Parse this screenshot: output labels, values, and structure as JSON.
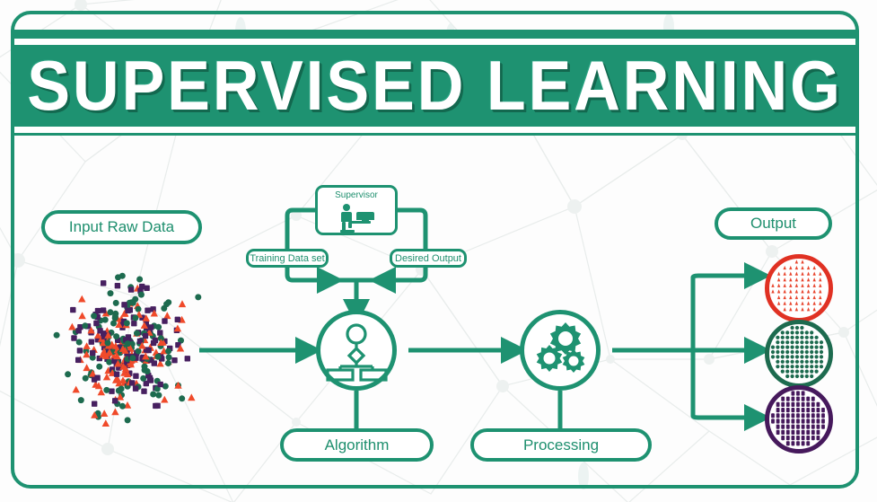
{
  "header": {
    "title": "SUPERVISED LEARNING",
    "banner_color": "#1e9271"
  },
  "diagram": {
    "input_label": "Input Raw Data",
    "output_label": "Output",
    "supervisor_label": "Supervisor",
    "training_label": "Training Data set",
    "desired_output_label": "Desired Output",
    "algorithm_label": "Algorithm",
    "processing_label": "Processing",
    "colors": {
      "green": "#1e9271",
      "green_text": "#1e8f6e",
      "red": "#e03123",
      "dark_green": "#1d6b4f",
      "purple": "#46195c",
      "scatter_green": "#1d6b4f",
      "scatter_red": "#f04a2a",
      "scatter_purple": "#472060"
    },
    "icons": {
      "algorithm": "flowchart-icon",
      "processing": "gears-icon",
      "supervisor": "person-at-desk-icon",
      "output_red": "person-grid-icon",
      "output_green": "dot-grid-icon",
      "output_purple": "bar-grid-icon"
    }
  }
}
